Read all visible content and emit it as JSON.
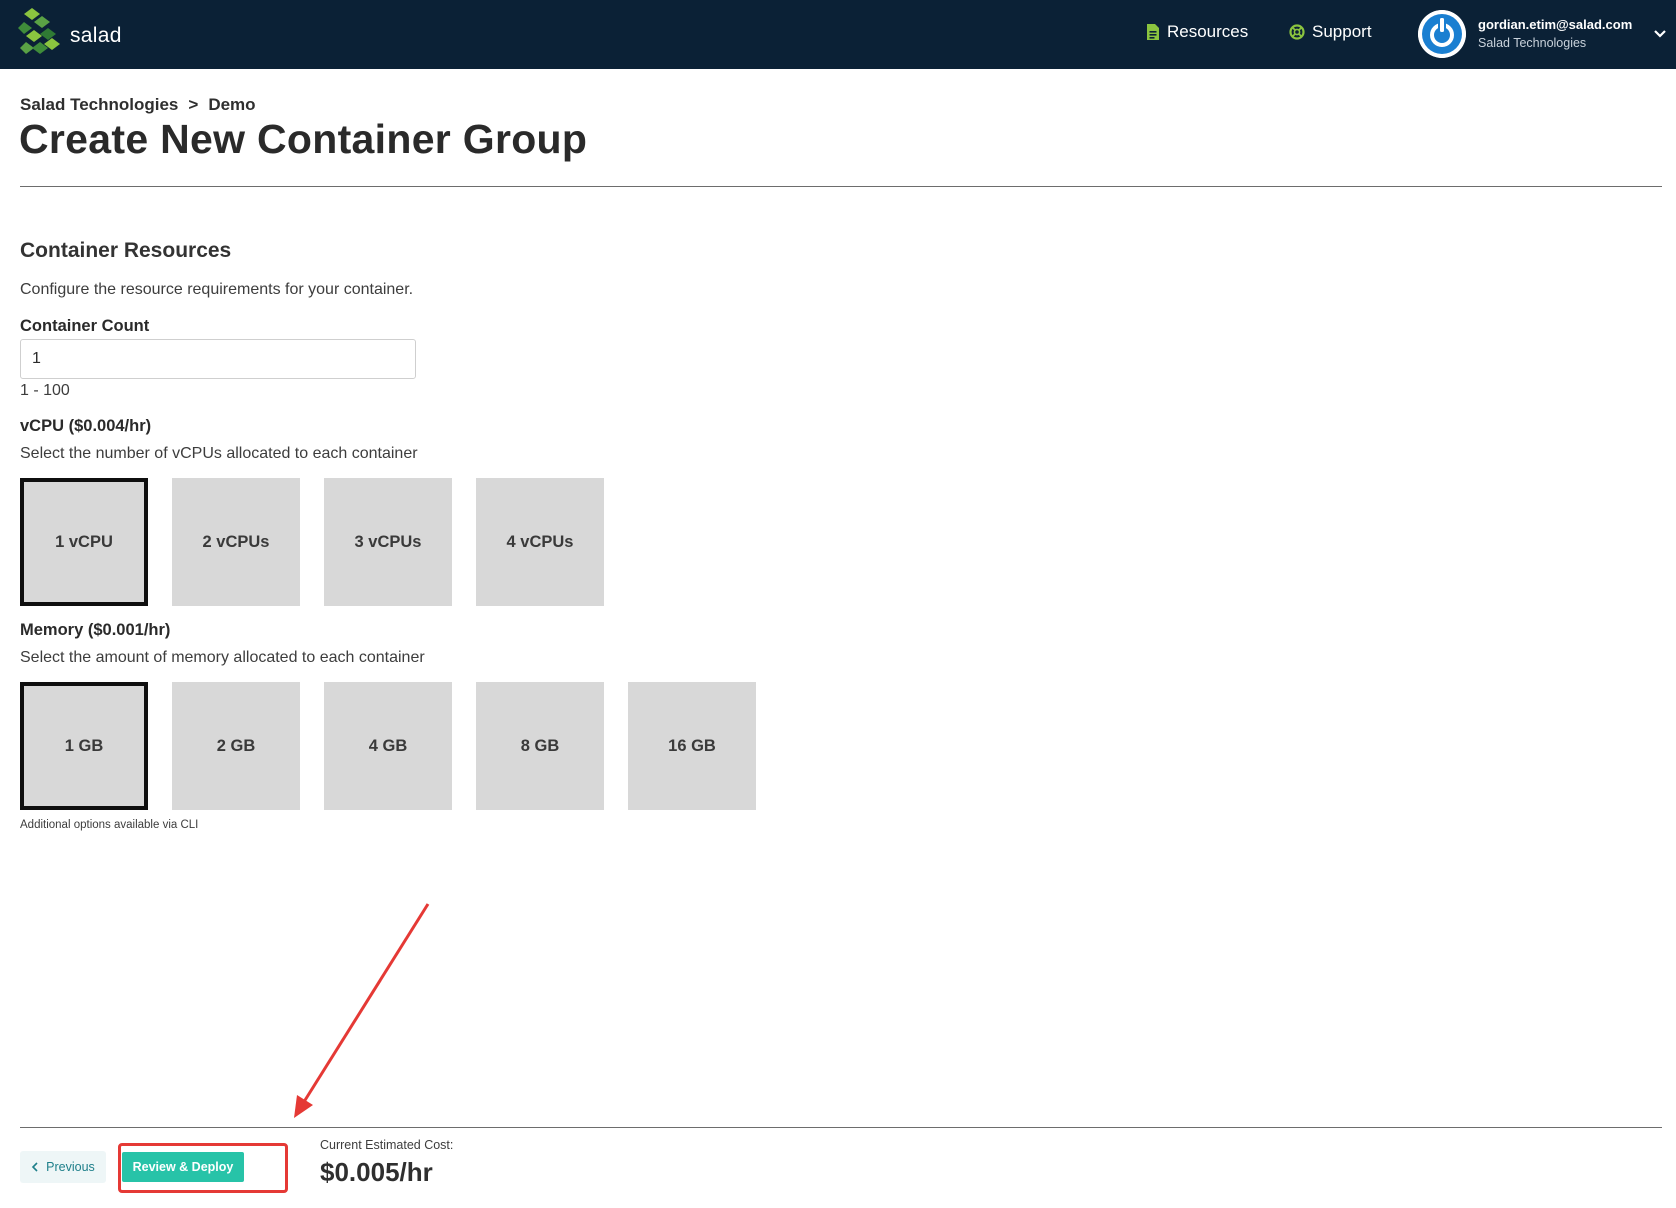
{
  "header": {
    "logo_text": "salad",
    "nav": [
      {
        "label": "Resources",
        "icon": "document-icon"
      },
      {
        "label": "Support",
        "icon": "lifebuoy-icon"
      }
    ],
    "user": {
      "email": "gordian.etim@salad.com",
      "org": "Salad Technologies"
    }
  },
  "breadcrumb": {
    "org": "Salad Technologies",
    "separator": ">",
    "project": "Demo"
  },
  "page_title": "Create New Container Group",
  "section": {
    "title": "Container Resources",
    "description": "Configure the resource requirements for your container."
  },
  "container_count": {
    "label": "Container Count",
    "value": "1",
    "hint": "1 - 100"
  },
  "vcpu": {
    "label": "vCPU ($0.004/hr)",
    "description": "Select the number of vCPUs allocated to each container",
    "options": [
      "1 vCPU",
      "2 vCPUs",
      "3 vCPUs",
      "4 vCPUs"
    ],
    "selected": "1 vCPU"
  },
  "memory": {
    "label": "Memory ($0.001/hr)",
    "description": "Select the amount of memory allocated to each container",
    "options": [
      "1 GB",
      "2 GB",
      "4 GB",
      "8 GB",
      "16 GB"
    ],
    "selected": "1 GB",
    "note": "Additional options available via CLI"
  },
  "footer": {
    "previous_label": "Previous",
    "deploy_label": "Review & Deploy",
    "cost_label": "Current Estimated Cost:",
    "cost_value": "$0.005/hr"
  },
  "colors": {
    "header_bg": "#0b2136",
    "brand_green": "#8bc43f",
    "deploy_button": "#27c3a8",
    "annotation_red": "#e53935"
  }
}
